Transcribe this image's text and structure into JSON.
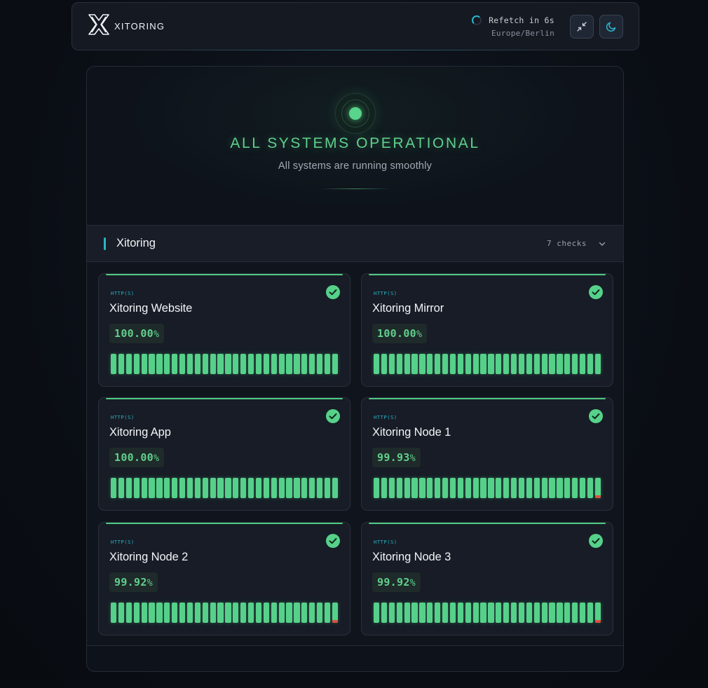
{
  "header": {
    "brand": "XITORING",
    "refetch_label": "Refetch in 6s",
    "timezone": "Europe/Berlin",
    "icons": {
      "logo": "xitoring-logo-icon",
      "collapse": "collapse-arrows-icon",
      "theme": "moon-icon",
      "spinner": "loading-spinner-icon"
    }
  },
  "hero": {
    "title": "ALL SYSTEMS OPERATIONAL",
    "subtitle": "All systems are running smoothly",
    "status_color": "#58d48b"
  },
  "group": {
    "name": "Xitoring",
    "count_label": "7 checks",
    "accent": "#2ab5c8"
  },
  "colors": {
    "up": "#56d18a",
    "down": "#d9503f",
    "type_label": "#2ab5c8"
  },
  "checks": [
    {
      "type": "HTTP(S)",
      "name": "Xitoring Website",
      "uptime": "100.00",
      "pct": "%",
      "bars": [
        1,
        1,
        1,
        1,
        1,
        1,
        1,
        1,
        1,
        1,
        1,
        1,
        1,
        1,
        1,
        1,
        1,
        1,
        1,
        1,
        1,
        1,
        1,
        1,
        1,
        1,
        1,
        1,
        1,
        1
      ]
    },
    {
      "type": "HTTP(S)",
      "name": "Xitoring Mirror",
      "uptime": "100.00",
      "pct": "%",
      "bars": [
        1,
        1,
        1,
        1,
        1,
        1,
        1,
        1,
        1,
        1,
        1,
        1,
        1,
        1,
        1,
        1,
        1,
        1,
        1,
        1,
        1,
        1,
        1,
        1,
        1,
        1,
        1,
        1,
        1,
        1
      ]
    },
    {
      "type": "HTTP(S)",
      "name": "Xitoring App",
      "uptime": "100.00",
      "pct": "%",
      "bars": [
        1,
        1,
        1,
        1,
        1,
        1,
        1,
        1,
        1,
        1,
        1,
        1,
        1,
        1,
        1,
        1,
        1,
        1,
        1,
        1,
        1,
        1,
        1,
        1,
        1,
        1,
        1,
        1,
        1,
        1
      ]
    },
    {
      "type": "HTTP(S)",
      "name": "Xitoring Node 1",
      "uptime": "99.93",
      "pct": "%",
      "bars": [
        1,
        1,
        1,
        1,
        1,
        1,
        1,
        1,
        1,
        1,
        1,
        1,
        1,
        1,
        1,
        1,
        1,
        1,
        1,
        1,
        1,
        1,
        1,
        1,
        1,
        1,
        1,
        1,
        1,
        0
      ]
    },
    {
      "type": "HTTP(S)",
      "name": "Xitoring Node 2",
      "uptime": "99.92",
      "pct": "%",
      "bars": [
        1,
        1,
        1,
        1,
        1,
        1,
        1,
        1,
        1,
        1,
        1,
        1,
        1,
        1,
        1,
        1,
        1,
        1,
        1,
        1,
        1,
        1,
        1,
        1,
        1,
        1,
        1,
        1,
        1,
        0
      ]
    },
    {
      "type": "HTTP(S)",
      "name": "Xitoring Node 3",
      "uptime": "99.92",
      "pct": "%",
      "bars": [
        1,
        1,
        1,
        1,
        1,
        1,
        1,
        1,
        1,
        1,
        1,
        1,
        1,
        1,
        1,
        1,
        1,
        1,
        1,
        1,
        1,
        1,
        1,
        1,
        1,
        1,
        1,
        1,
        1,
        0
      ]
    }
  ]
}
